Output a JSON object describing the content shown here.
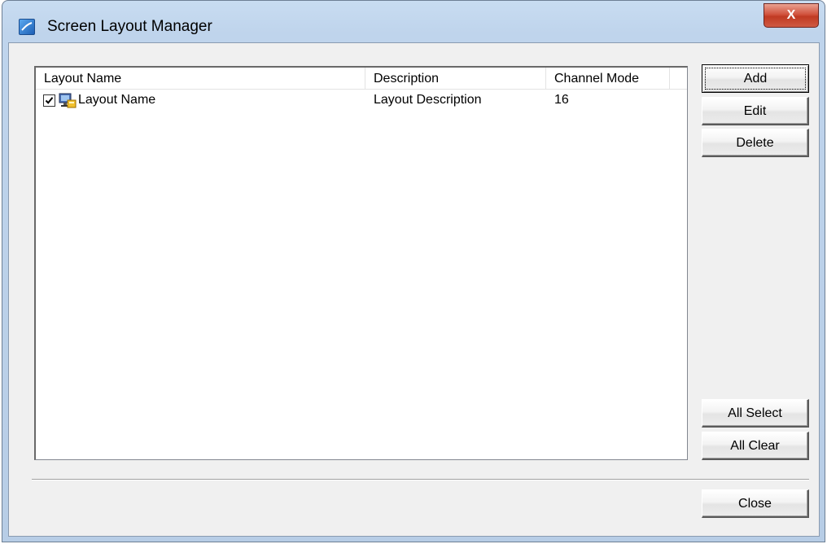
{
  "window": {
    "title": "Screen Layout Manager",
    "close_label": "X"
  },
  "listview": {
    "columns": [
      {
        "label": "Layout Name"
      },
      {
        "label": "Description"
      },
      {
        "label": "Channel Mode"
      }
    ],
    "rows": [
      {
        "checked": true,
        "name": "Layout Name",
        "description": "Layout Description",
        "channel_mode": "16"
      }
    ]
  },
  "buttons": {
    "add": "Add",
    "edit": "Edit",
    "delete": "Delete",
    "all_select": "All Select",
    "all_clear": "All Clear",
    "close": "Close"
  },
  "colors": {
    "title_bar": "#bfd4ec",
    "close_button": "#c03a22",
    "dialog_bg": "#f0f0f0"
  }
}
